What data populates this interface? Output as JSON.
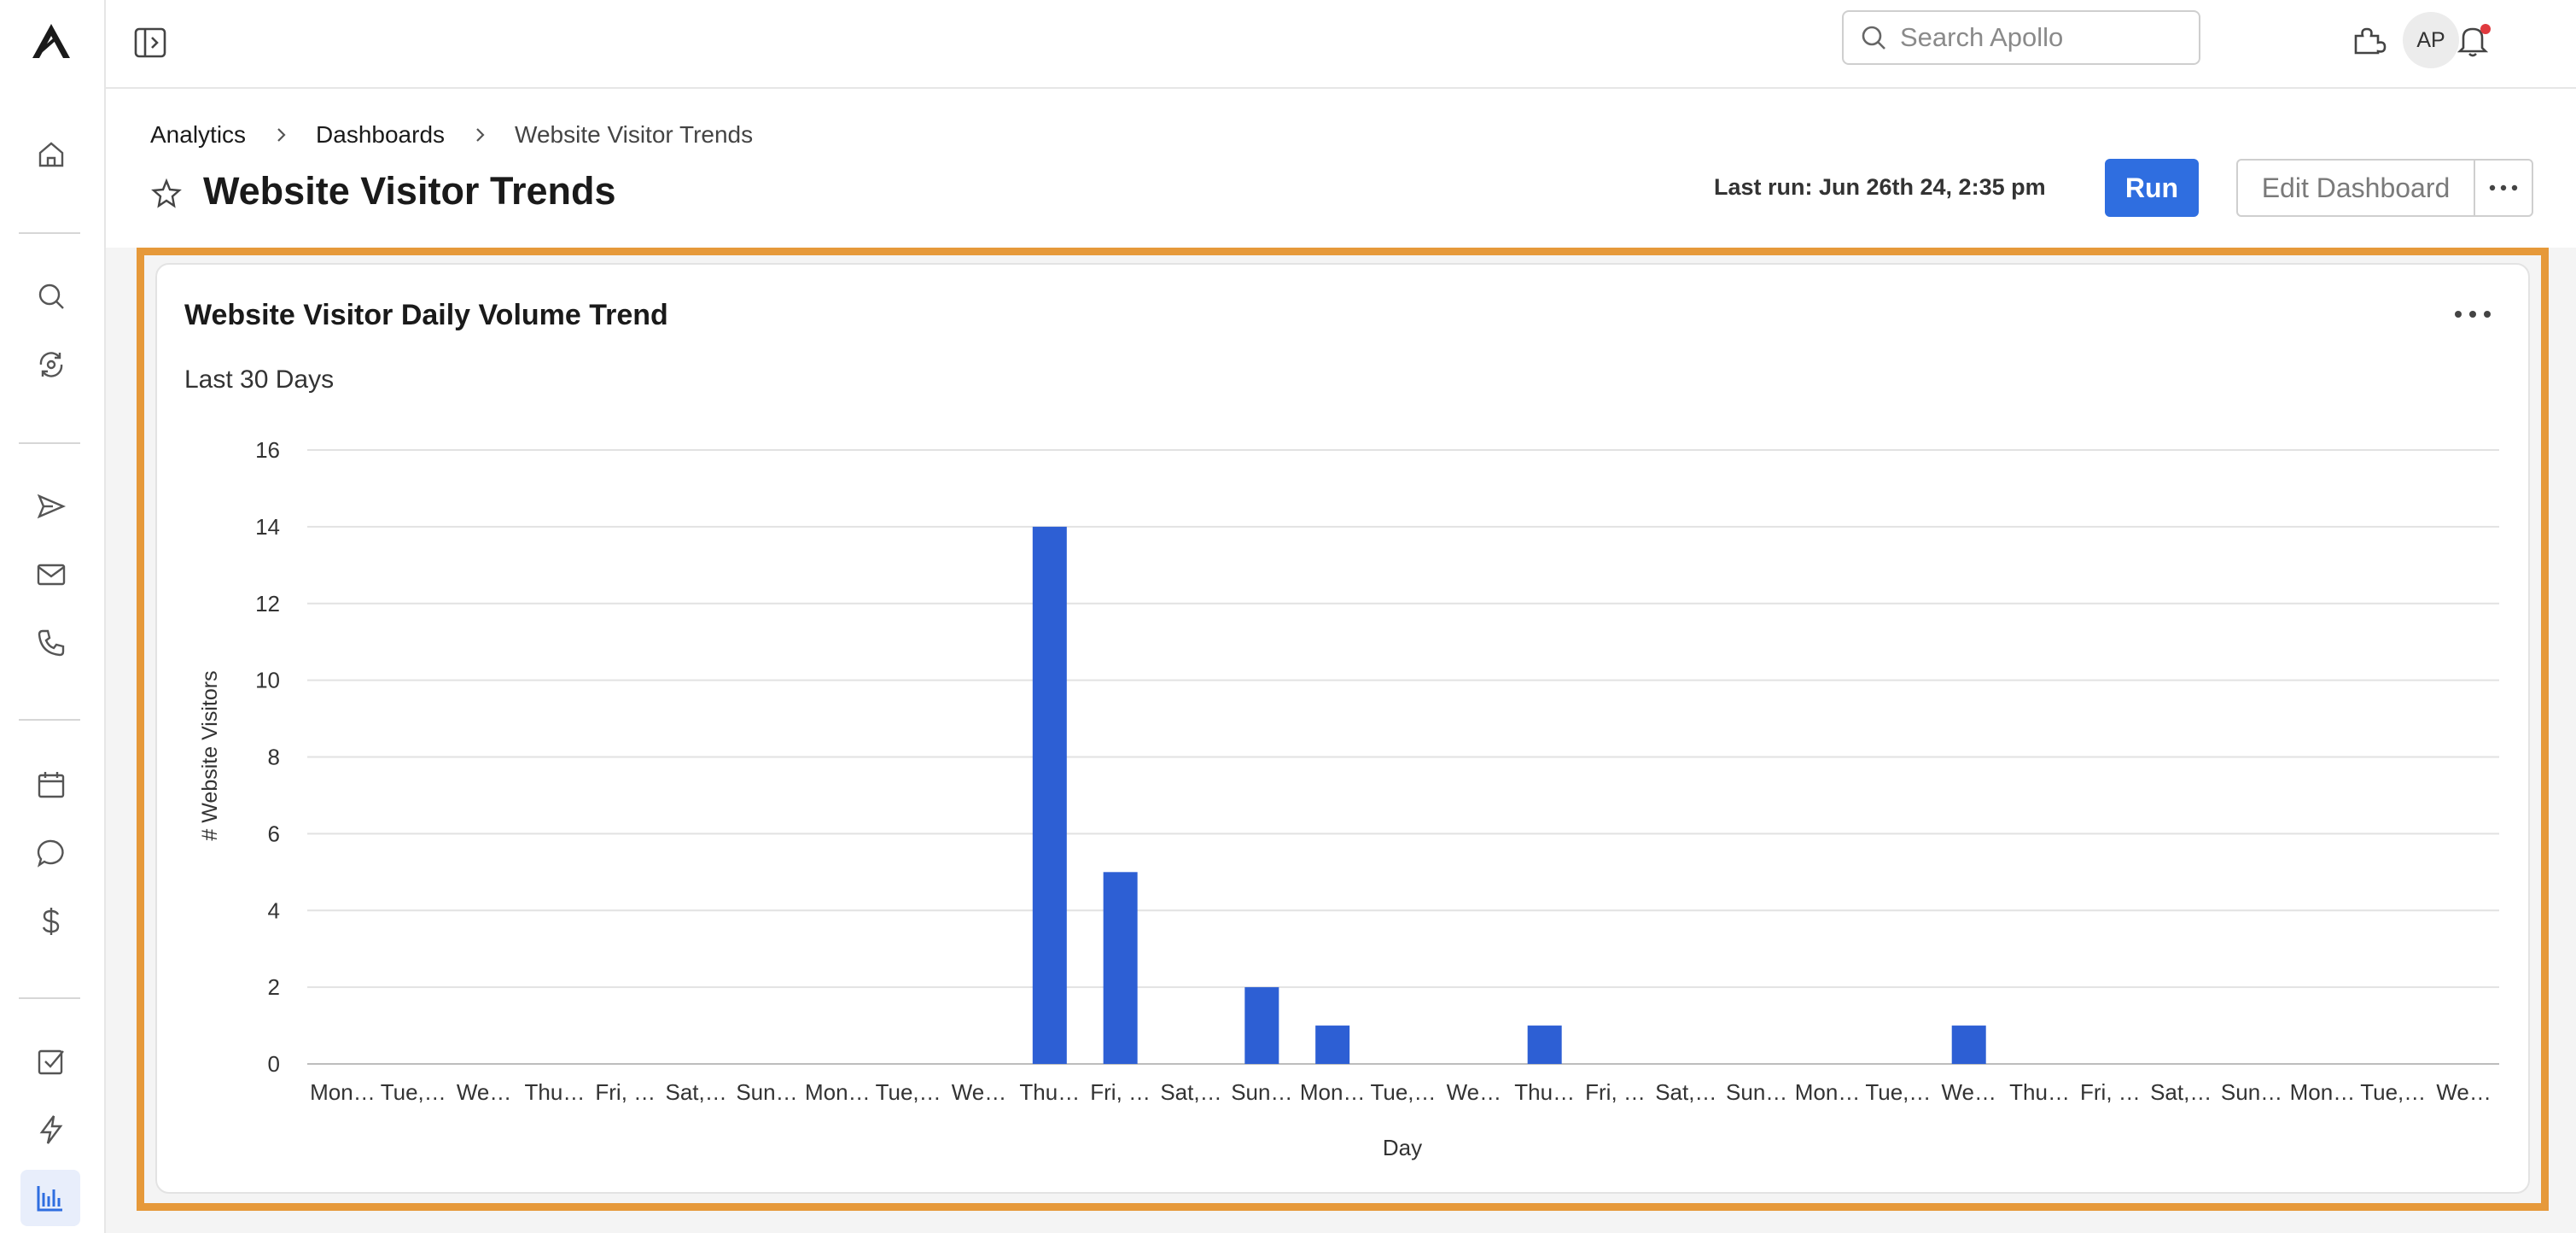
{
  "topbar": {
    "search_placeholder": "Search Apollo",
    "avatar_initials": "AP"
  },
  "breadcrumb": [
    "Analytics",
    "Dashboards",
    "Website Visitor Trends"
  ],
  "header": {
    "title": "Website Visitor Trends",
    "last_run": "Last run: Jun 26th 24, 2:35 pm",
    "run_label": "Run",
    "edit_label": "Edit Dashboard"
  },
  "card": {
    "title": "Website Visitor Daily Volume Trend",
    "subtitle": "Last 30 Days"
  },
  "colors": {
    "accent": "#2f6ee0",
    "bar": "#2d5fd4",
    "highlight": "#e6993a",
    "notification": "#e0393e"
  },
  "sidebar_icons": [
    "home-icon",
    "search-icon",
    "refresh-search-icon",
    "send-icon",
    "mail-icon",
    "phone-icon",
    "calendar-icon",
    "chat-icon",
    "dollar-icon",
    "checkbox-icon",
    "lightning-icon",
    "analytics-icon"
  ],
  "chart_data": {
    "type": "bar",
    "categories": [
      "Mon…",
      "Tue,…",
      "We…",
      "Thu…",
      "Fri, …",
      "Sat,…",
      "Sun…",
      "Mon…",
      "Tue,…",
      "We…",
      "Thu…",
      "Fri, …",
      "Sat,…",
      "Sun…",
      "Mon…",
      "Tue,…",
      "We…",
      "Thu…",
      "Fri, …",
      "Sat,…",
      "Sun…",
      "Mon…",
      "Tue,…",
      "We…",
      "Thu…",
      "Fri, …",
      "Sat,…",
      "Sun…",
      "Mon…",
      "Tue,…",
      "We…"
    ],
    "values": [
      0,
      0,
      0,
      0,
      0,
      0,
      0,
      0,
      0,
      0,
      14,
      5,
      0,
      2,
      1,
      0,
      0,
      1,
      0,
      0,
      0,
      0,
      0,
      1,
      0,
      0,
      0,
      0,
      0,
      0,
      0
    ],
    "xlabel": "Day",
    "ylabel": "# Website Visitors",
    "ylim": [
      0,
      16
    ],
    "yticks": [
      0,
      2,
      4,
      6,
      8,
      10,
      12,
      14,
      16
    ],
    "grid": true
  }
}
